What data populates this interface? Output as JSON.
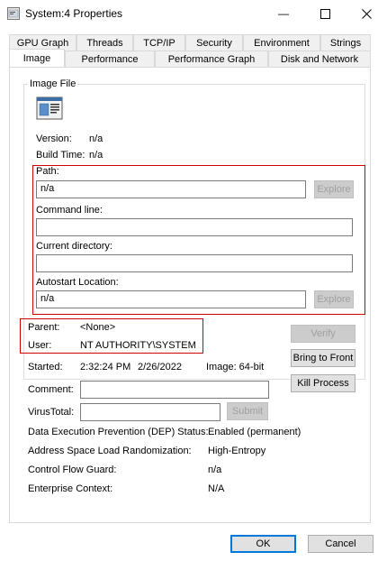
{
  "window": {
    "title": "System:4 Properties",
    "minimize_glyph": "—",
    "maximize_glyph": "☐",
    "close_glyph": "✕"
  },
  "tabs": {
    "row1": [
      "GPU Graph",
      "Threads",
      "TCP/IP",
      "Security",
      "Environment",
      "Strings"
    ],
    "row2": [
      "Image",
      "Performance",
      "Performance Graph",
      "Disk and Network"
    ],
    "active": "Image"
  },
  "image_file": {
    "group_label": "Image File",
    "version_label": "Version:",
    "version_value": "n/a",
    "build_time_label": "Build Time:",
    "build_time_value": "n/a"
  },
  "path": {
    "label": "Path:",
    "value": "n/a",
    "explore_label": "Explore"
  },
  "command_line": {
    "label": "Command line:",
    "value": ""
  },
  "current_directory": {
    "label": "Current directory:",
    "value": ""
  },
  "autostart": {
    "label": "Autostart Location:",
    "value": "n/a",
    "explore_label": "Explore"
  },
  "parent": {
    "label": "Parent:",
    "value": "<None>"
  },
  "user": {
    "label": "User:",
    "value": "NT AUTHORITY\\SYSTEM"
  },
  "started": {
    "label": "Started:",
    "time": "2:32:24 PM",
    "date": "2/26/2022",
    "image_bits": "Image: 64-bit"
  },
  "comment": {
    "label": "Comment:",
    "value": ""
  },
  "virustotal": {
    "label": "VirusTotal:",
    "value": "",
    "submit_label": "Submit"
  },
  "side_buttons": {
    "verify": "Verify",
    "bring_to_front": "Bring to Front",
    "kill_process": "Kill Process"
  },
  "details": [
    {
      "label": "Data Execution Prevention (DEP) Status:",
      "value": "Enabled (permanent)"
    },
    {
      "label": "Address Space Load Randomization:",
      "value": "High-Entropy"
    },
    {
      "label": "Control Flow Guard:",
      "value": "n/a"
    },
    {
      "label": "Enterprise Context:",
      "value": "N/A"
    }
  ],
  "footer": {
    "ok": "OK",
    "cancel": "Cancel"
  },
  "colors": {
    "highlight_box": "#cc0000",
    "primary_border": "#0078d7"
  },
  "icons": {
    "app": "process-explorer-icon",
    "image": "executable-image-icon"
  }
}
